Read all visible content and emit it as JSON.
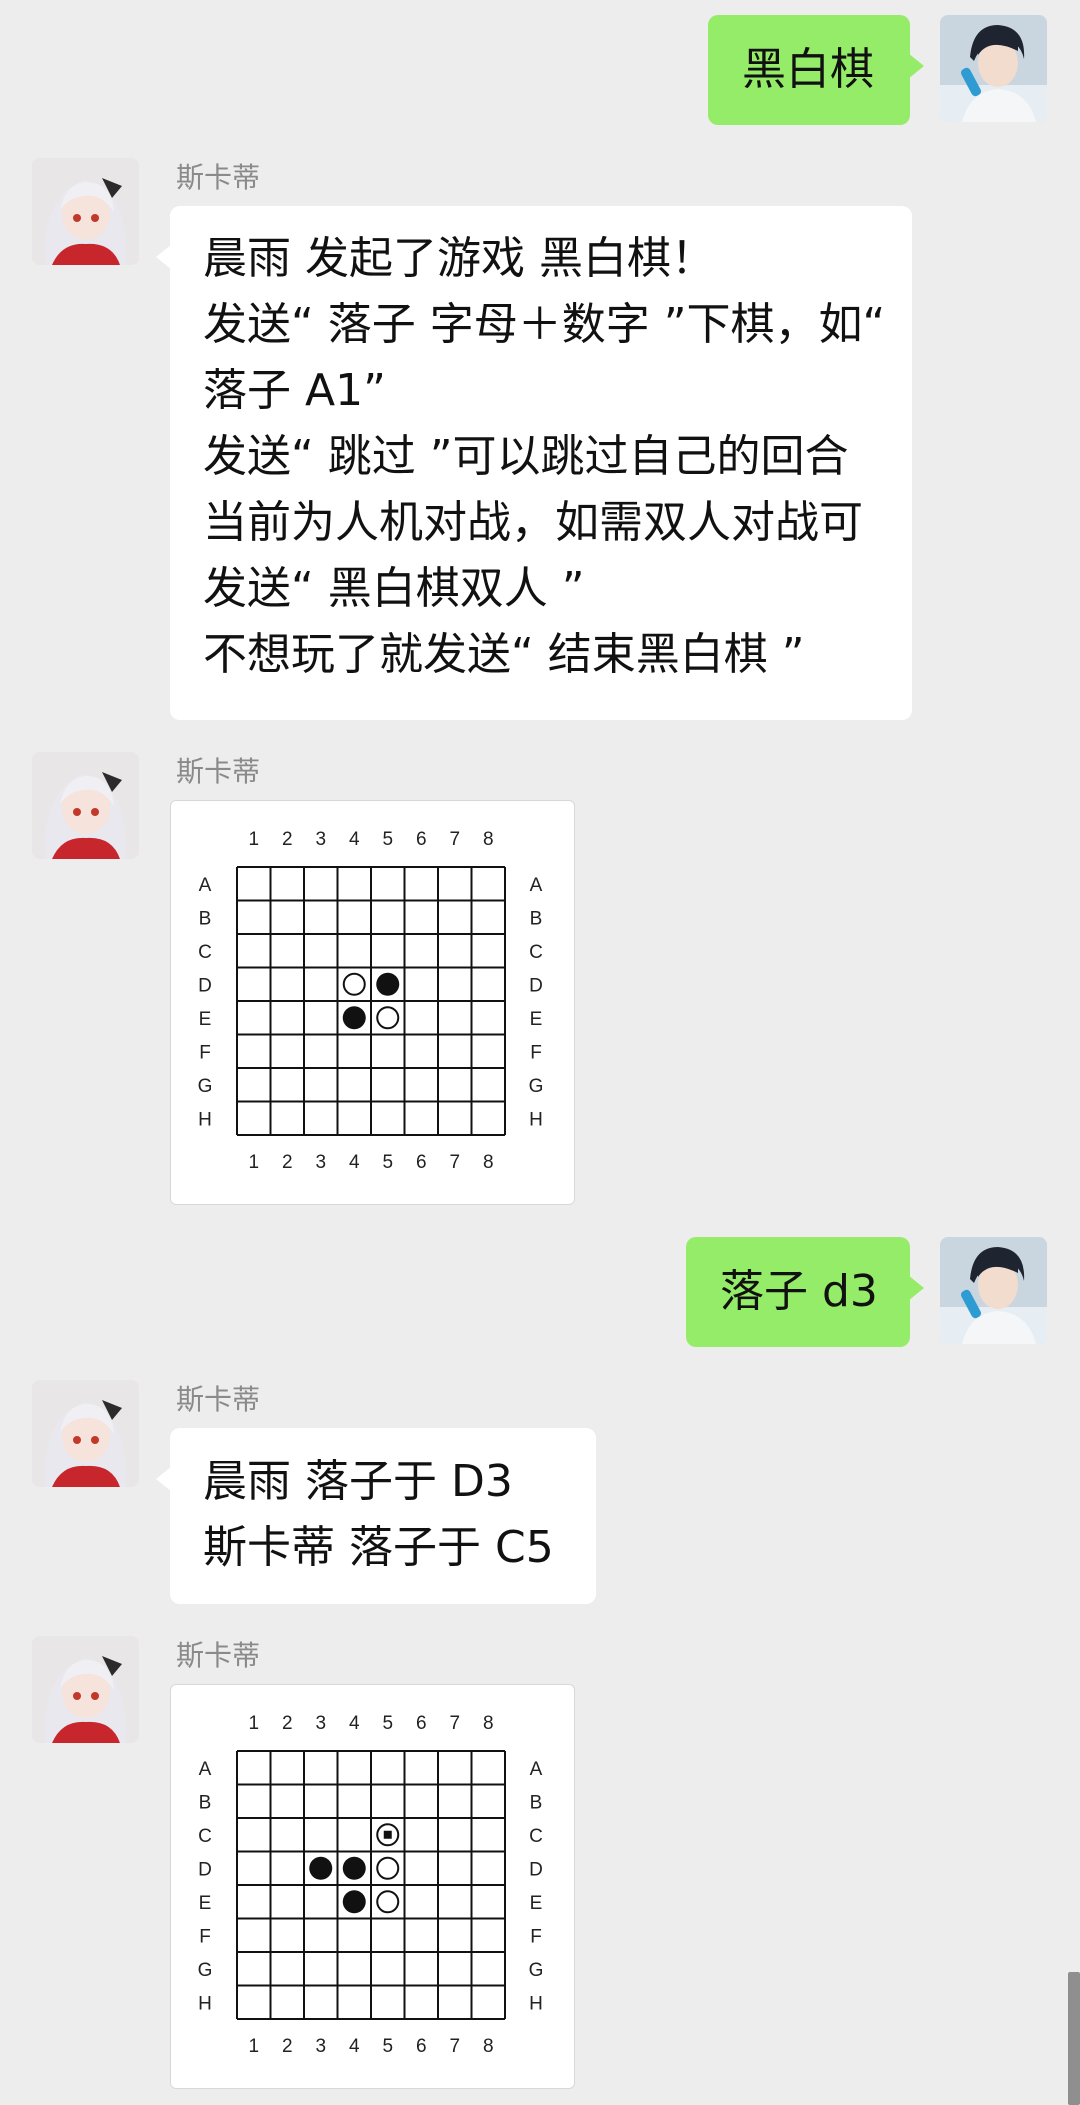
{
  "messages": [
    {
      "type": "text",
      "side": "me",
      "lines": [
        "黑白棋"
      ]
    },
    {
      "type": "text",
      "side": "other",
      "sender": "斯卡蒂",
      "lines": [
        "晨雨 发起了游戏 黑白棋！",
        "发送“ 落子 字母＋数字 ”下棋，如“",
        "落子 A1”",
        "发送“ 跳过 ”可以跳过自己的回合",
        "当前为人机对战，如需双人对战可",
        "发送“ 黑白棋双人 ”",
        "不想玩了就发送“ 结束黑白棋 ”"
      ]
    },
    {
      "type": "board",
      "side": "other",
      "sender": "斯卡蒂"
    },
    {
      "type": "text",
      "side": "me",
      "lines": [
        "落子 d3"
      ]
    },
    {
      "type": "text",
      "side": "other",
      "sender": "斯卡蒂",
      "lines": [
        "晨雨 落子于 D3",
        "斯卡蒂 落子于 C5"
      ]
    },
    {
      "type": "board",
      "side": "other",
      "sender": "斯卡蒂"
    }
  ],
  "board": {
    "col_labels": [
      "1",
      "2",
      "3",
      "4",
      "5",
      "6",
      "7",
      "8"
    ],
    "row_labels": [
      "A",
      "B",
      "C",
      "D",
      "E",
      "F",
      "G",
      "H"
    ]
  },
  "boards": [
    {
      "stones": [
        {
          "cell": "D4",
          "color": "white"
        },
        {
          "cell": "D5",
          "color": "black"
        },
        {
          "cell": "E4",
          "color": "black"
        },
        {
          "cell": "E5",
          "color": "white"
        }
      ]
    },
    {
      "stones": [
        {
          "cell": "C5",
          "color": "white",
          "last": true
        },
        {
          "cell": "D3",
          "color": "black"
        },
        {
          "cell": "D4",
          "color": "black"
        },
        {
          "cell": "D5",
          "color": "white"
        },
        {
          "cell": "E4",
          "color": "black"
        },
        {
          "cell": "E5",
          "color": "white"
        }
      ]
    }
  ],
  "colors": {
    "self_bubble": "#95ec69",
    "other_bubble": "#ffffff",
    "background": "#ededed"
  }
}
